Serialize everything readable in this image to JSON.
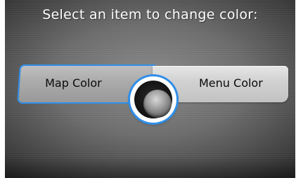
{
  "screen": {
    "prompt": "Select an item to change color:"
  },
  "options": {
    "map_color": "Map Color",
    "menu_color": "Menu Color"
  },
  "colors": {
    "highlight": "#2f8ee8",
    "text": "#ffffff"
  },
  "icons": {
    "selector": "joystick-knob-icon"
  }
}
